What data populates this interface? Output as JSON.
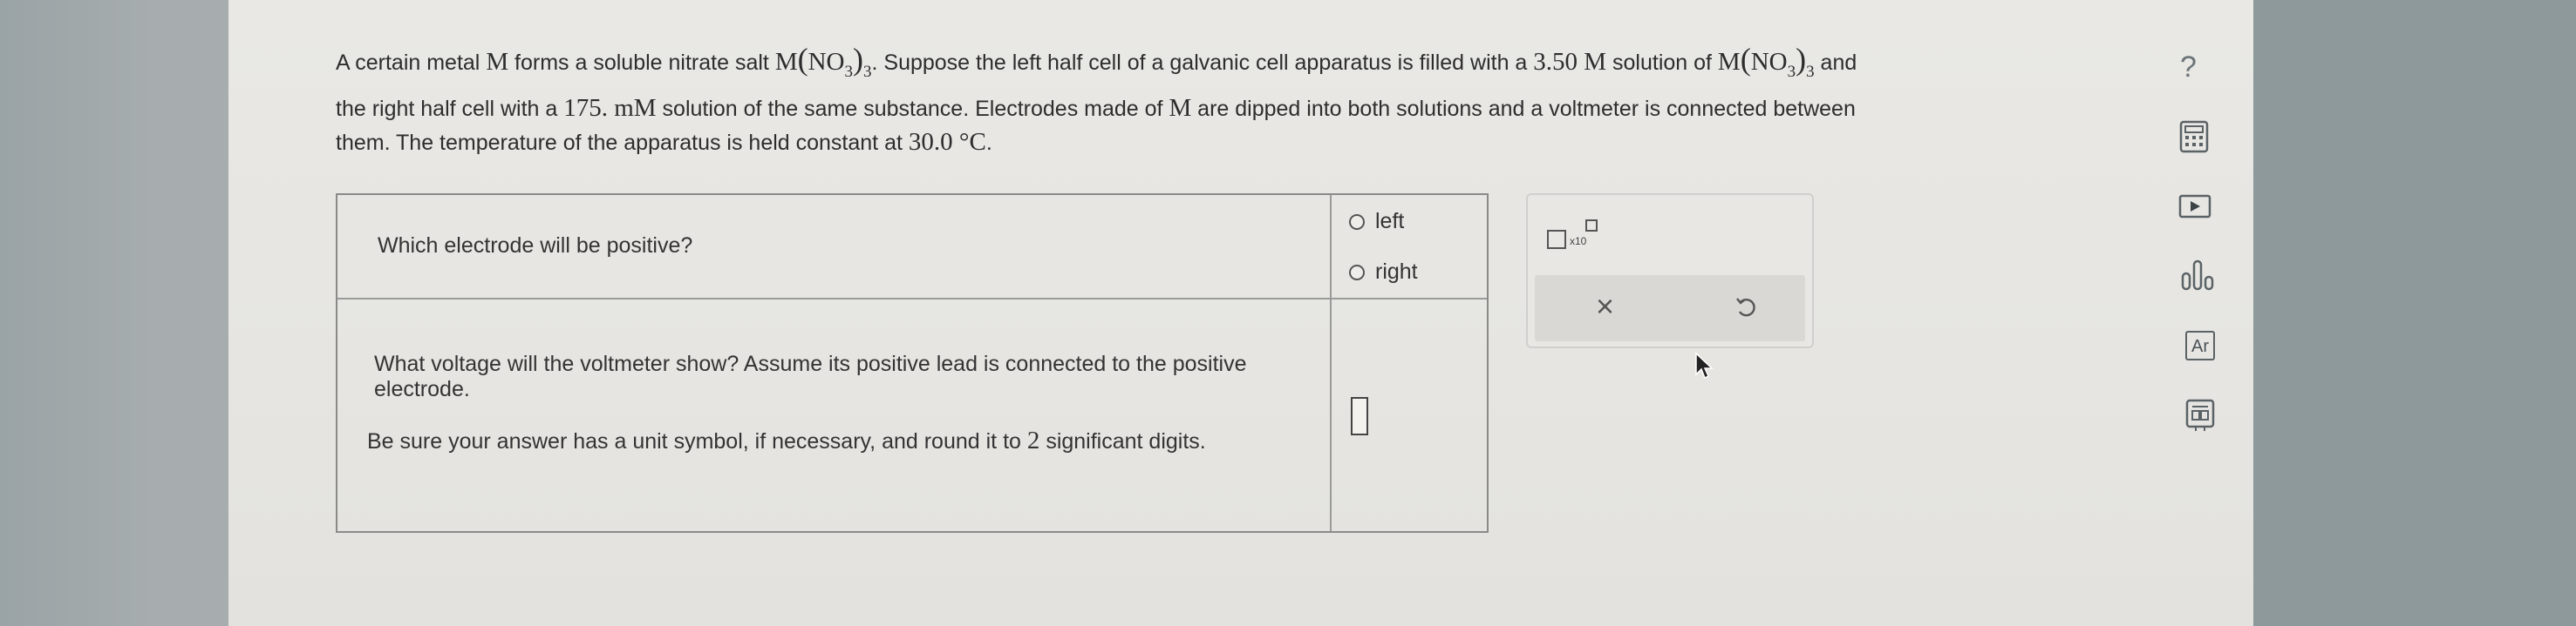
{
  "problem": {
    "line1_a": "A certain metal ",
    "metal_symbol": "M",
    "line1_b": " forms a soluble nitrate salt ",
    "salt_M": "M",
    "salt_NO": "NO",
    "salt_sub3": "3",
    "salt_sub_outer": "3",
    "line1_c": ". Suppose the left half cell of a galvanic cell apparatus is filled with a ",
    "left_conc": "3.50 M",
    "line1_d": " solution of ",
    "line1_e": " and",
    "line2_a": "the right half cell with a ",
    "right_conc": "175. mM",
    "line2_b": " solution of the same substance. Electrodes made of ",
    "line2_c": " are dipped into both solutions and a voltmeter is connected between",
    "line3_a": "them. The temperature of the apparatus is held constant at ",
    "temperature": "30.0 °C",
    "line3_b": "."
  },
  "question1": {
    "text": "Which electrode will be positive?",
    "options": [
      "left",
      "right"
    ]
  },
  "question2": {
    "text1": "What voltage will the voltmeter show? Assume its positive lead is connected to the positive electrode.",
    "text2_a": "Be sure your answer has a unit symbol, if necessary, and round it to ",
    "sig_figs": "2",
    "text2_b": " significant digits."
  },
  "toolpanel": {
    "sci_label": "x10",
    "clear_label": "×"
  },
  "sidebar": {
    "help_label": "?",
    "icons": [
      "calculator-icon",
      "video-icon",
      "chart-icon",
      "periodic-table-icon",
      "reference-icon"
    ],
    "periodic_label": "Ar"
  }
}
